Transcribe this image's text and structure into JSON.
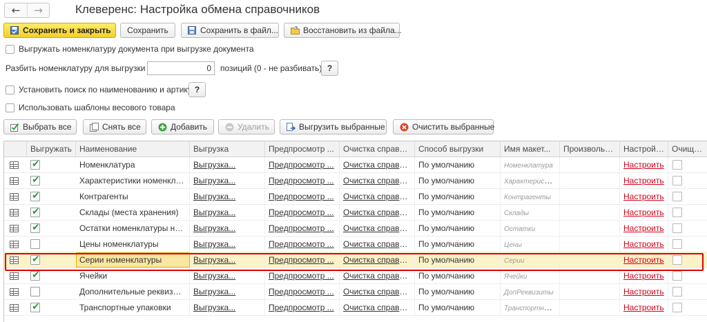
{
  "nav": {
    "back_glyph": "←",
    "forward_glyph": "→"
  },
  "window": {
    "title": "Клеверенс: Настройка обмена справочников"
  },
  "toolbar": {
    "save_close": "Сохранить и закрыть",
    "save": "Сохранить",
    "save_to_file": "Сохранить в файл...",
    "restore_from_file": "Восстановить из файла..."
  },
  "options": {
    "export_doc_items": "Выгружать номенклатуру документа при выгрузке документа",
    "split_label": "Разбить номенклатуру для выгрузки по:",
    "split_value": "0",
    "split_suffix": "позиций (0 - не разбивать)",
    "help": "?",
    "search_by_name": "Установить поиск по наименованию и артикулу",
    "weight_templates": "Использовать шаблоны весового товара"
  },
  "actions": {
    "select_all": "Выбрать все",
    "deselect_all": "Снять все",
    "add": "Добавить",
    "delete": "Удалить",
    "export_selected": "Выгрузить выбранные",
    "clear_selected": "Очистить выбранные"
  },
  "table": {
    "columns": [
      "Выгружать",
      "Наименование",
      "Выгрузка",
      "Предпросмотр ...",
      "Очистка справо...",
      "Способ выгрузки",
      "Имя макет...",
      "Произвольн...",
      "Настройка",
      "Очищать"
    ],
    "rows": [
      {
        "export": true,
        "name": "Номенклатура",
        "upload": "Выгрузка...",
        "preview": "Предпросмотр ...",
        "clear": "Очистка справо...",
        "mode": "По умолчанию",
        "layout": "Номенклатура",
        "custom": "",
        "setup": "Настроить",
        "purge": false
      },
      {
        "export": true,
        "name": "Характеристики номенклат...",
        "upload": "Выгрузка...",
        "preview": "Предпросмотр ...",
        "clear": "Очистка справо...",
        "mode": "По умолчанию",
        "layout": "Характеристи...",
        "custom": "",
        "setup": "Настроить",
        "purge": false
      },
      {
        "export": true,
        "name": "Контрагенты",
        "upload": "Выгрузка...",
        "preview": "Предпросмотр ...",
        "clear": "Очистка справо...",
        "mode": "По умолчанию",
        "layout": "Контрагенты",
        "custom": "",
        "setup": "Настроить",
        "purge": false
      },
      {
        "export": true,
        "name": "Склады (места хранения)",
        "upload": "Выгрузка...",
        "preview": "Предпросмотр ...",
        "clear": "Очистка справо...",
        "mode": "По умолчанию",
        "layout": "Склады",
        "custom": "",
        "setup": "Настроить",
        "purge": false
      },
      {
        "export": true,
        "name": "Остатки номенклатуры на ...",
        "upload": "Выгрузка...",
        "preview": "Предпросмотр ...",
        "clear": "Очистка справо...",
        "mode": "По умолчанию",
        "layout": "Остатки",
        "custom": "",
        "setup": "Настроить",
        "purge": false
      },
      {
        "export": false,
        "name": "Цены номенклатуры",
        "upload": "Выгрузка...",
        "preview": "Предпросмотр ...",
        "clear": "Очистка справо...",
        "mode": "По умолчанию",
        "layout": "Цены",
        "custom": "",
        "setup": "Настроить",
        "purge": false
      },
      {
        "export": true,
        "name": "Серии номенклатуры",
        "upload": "Выгрузка...",
        "preview": "Предпросмотр ...",
        "clear": "Очистка справо...",
        "mode": "По умолчанию",
        "layout": "Серии",
        "custom": "",
        "setup": "Настроить",
        "purge": false,
        "selected": true
      },
      {
        "export": true,
        "name": "Ячейки",
        "upload": "Выгрузка...",
        "preview": "Предпросмотр ...",
        "clear": "Очистка справо...",
        "mode": "По умолчанию",
        "layout": "Ячейки",
        "custom": "",
        "setup": "Настроить",
        "purge": false
      },
      {
        "export": false,
        "name": "Дополнительные реквизиты",
        "upload": "Выгрузка...",
        "preview": "Предпросмотр ...",
        "clear": "Очистка справо...",
        "mode": "По умолчанию",
        "layout": "ДопРеквизиты",
        "custom": "",
        "setup": "Настроить",
        "purge": false
      },
      {
        "export": true,
        "name": "Транспортные упаковки",
        "upload": "Выгрузка...",
        "preview": "Предпросмотр ...",
        "clear": "Очистка справо...",
        "mode": "По умолчанию",
        "layout": "Транспортные...",
        "custom": "",
        "setup": "Настроить",
        "purge": false
      }
    ]
  },
  "colors": {
    "primary_button": "#f4d026",
    "link_red": "#d0021b",
    "check_green": "#2e9d38",
    "selection_frame": "#e30000"
  }
}
